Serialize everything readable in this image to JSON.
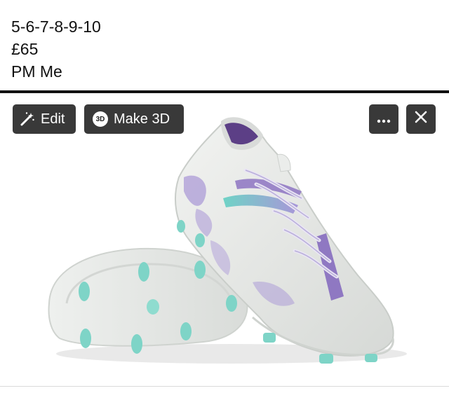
{
  "post": {
    "sizes": "5-6-7-8-9-10",
    "price": "£65",
    "contact": "PM Me"
  },
  "toolbar": {
    "edit_label": "Edit",
    "make3d_label": "Make 3D",
    "badge_3d": "3D"
  },
  "icons": {
    "edit": "magic-wand-icon",
    "make3d": "3d-badge-icon",
    "more": "more-dots-icon",
    "close": "close-icon"
  },
  "colors": {
    "toolbar_bg": "#282828",
    "boot_white": "#e9ebe8",
    "accent_purple": "#9b86c8",
    "accent_teal": "#6fd3c6"
  }
}
